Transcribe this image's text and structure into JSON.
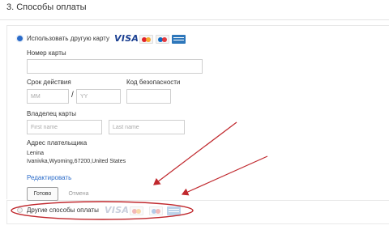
{
  "section": {
    "title": "3. Способы оплаты"
  },
  "card_option": {
    "label": "Использовать другую карту"
  },
  "card_number": {
    "label": "Номер карты",
    "value": ""
  },
  "expiry": {
    "label": "Срок действия",
    "month_placeholder": "MM",
    "year_placeholder": "YY",
    "separator": "/"
  },
  "security_code": {
    "label": "Код безопасности",
    "value": ""
  },
  "card_holder": {
    "label": "Владелец карты",
    "first_name_placeholder": "First name",
    "last_name_placeholder": "Last name"
  },
  "billing_address": {
    "label": "Адрес плательщика",
    "name": "Lenina",
    "address_line": "Ivanivka,Wyoming,67200,United States"
  },
  "edit_link": {
    "label": "Редактировать"
  },
  "buttons": {
    "done": "Готово",
    "cancel": "Отмена"
  },
  "other_option": {
    "label": "Другие способы оплаты"
  },
  "card_logos": {
    "visa_text": "VISA",
    "icons": [
      "mastercard-icon",
      "maestro-icon",
      "amex-icon"
    ]
  },
  "colors": {
    "link": "#2a6bc9",
    "visa": "#1a3f91",
    "annotation": "#c0282d",
    "radio_selected": "#2a6bc9"
  }
}
